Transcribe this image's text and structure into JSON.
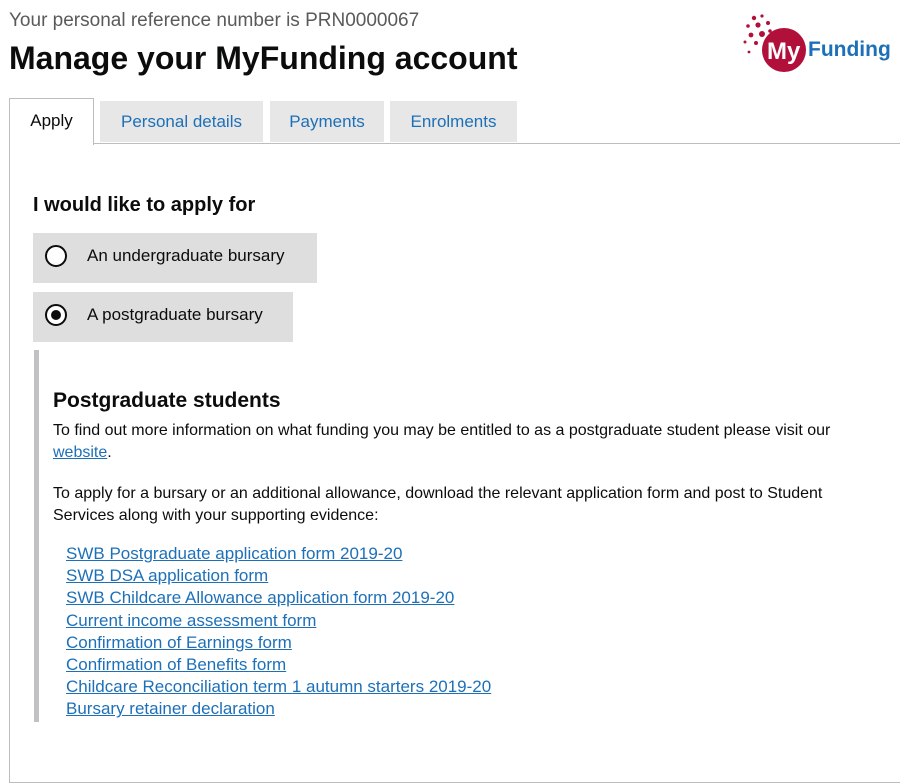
{
  "header": {
    "reference_text": "Your personal reference number is PRN0000067",
    "title": "Manage your MyFunding account",
    "logo": {
      "prefix": "My",
      "suffix": "Funding",
      "brand_color": "#b0103a",
      "text_color": "#1d70b8"
    }
  },
  "tabs": [
    {
      "label": "Apply",
      "active": true
    },
    {
      "label": "Personal details",
      "active": false
    },
    {
      "label": "Payments",
      "active": false
    },
    {
      "label": "Enrolments",
      "active": false
    }
  ],
  "apply": {
    "legend": "I would like to apply for",
    "options": [
      {
        "label": "An undergraduate bursary",
        "selected": false
      },
      {
        "label": "A postgraduate bursary",
        "selected": true
      }
    ]
  },
  "postgraduate": {
    "heading": "Postgraduate students",
    "intro_before_link": "To find out more information on what funding you may be entitled to as a postgraduate student please visit our ",
    "intro_link": "website",
    "intro_after_link": ".",
    "instructions": "To apply for a bursary or an additional allowance, download the relevant application form and post to Student Services along with your supporting evidence:",
    "links": [
      "SWB Postgraduate application form 2019-20",
      "SWB DSA application form",
      "SWB Childcare Allowance application form 2019-20",
      "Current income assessment form",
      "Confirmation of Earnings form",
      "Confirmation of Benefits form",
      "Childcare Reconciliation term 1 autumn starters 2019-20",
      "Bursary retainer declaration"
    ]
  },
  "colors": {
    "link": "#1d70b8",
    "text": "#0b0c0c",
    "tab_bg": "#e7e7e7",
    "radio_bg": "#dedede",
    "inset_bar": "#bfc1c3"
  }
}
